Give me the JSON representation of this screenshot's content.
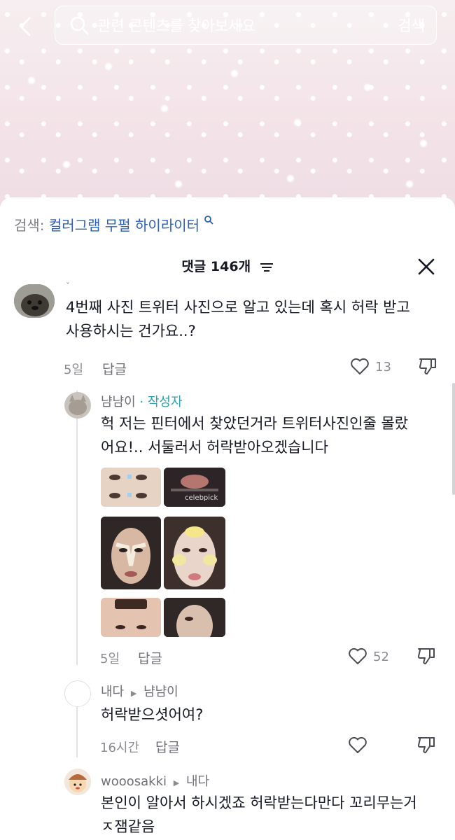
{
  "header": {
    "search_placeholder": "관련 콘텐츠를 찾아보세요",
    "search_button": "검색"
  },
  "search_hint": {
    "label": "검색:",
    "keyword": "컬러그램 무펄 하이라이터"
  },
  "comments": {
    "title": "댓글 146개",
    "items": [
      {
        "text_line1": "4번째 사진 트위터 사진으로 알고 있는데 혹시 허락 받고",
        "text_line2": "사용하시는 건가요..?",
        "time": "5일",
        "reply": "답글",
        "likes": "13"
      },
      {
        "username": "냠냠이",
        "author_tag": "· 작성자",
        "text_line1": "헉 저는 핀터에서 찾았던거라 트위터사진인줄 몰랐",
        "text_line2": "어요!.. 서둘러서 허락받아오겠습니다",
        "time": "5일",
        "reply": "답글",
        "likes": "52",
        "image_caption": "celebpick"
      },
      {
        "username": "내다",
        "reply_to": "냠냠이",
        "text_line1": "허락받으셧어여?",
        "time": "16시간",
        "reply": "답글",
        "likes": ""
      },
      {
        "username": "wooosakki",
        "reply_to": "내다",
        "text_line1": "본인이 알아서 하시겠죠 허락받는다만다 꼬리무는거",
        "text_line2": "ㅈ잼같음"
      }
    ]
  },
  "colors": {
    "link_blue": "#2b5fb8",
    "author_teal": "#2b9fb0",
    "meta_gray": "#8a8b91"
  }
}
